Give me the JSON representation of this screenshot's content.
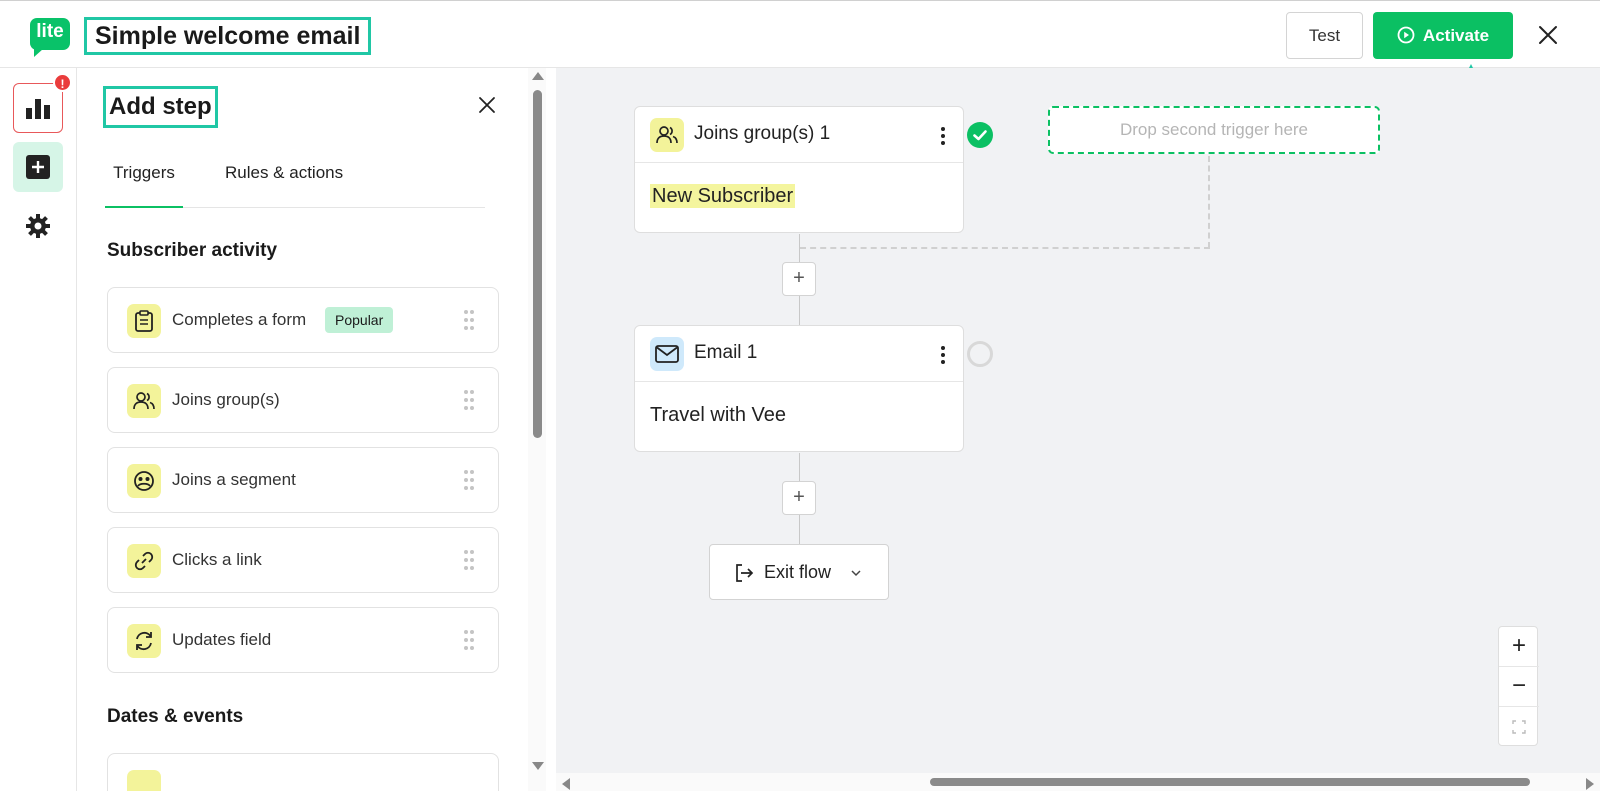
{
  "header": {
    "logo_text": "lite",
    "title": "Simple welcome email",
    "test_label": "Test",
    "activate_label": "Activate"
  },
  "rail": {
    "alert_badge": "!"
  },
  "panel": {
    "title": "Add step",
    "tabs": [
      {
        "label": "Triggers",
        "active": true
      },
      {
        "label": "Rules & actions",
        "active": false
      }
    ],
    "sections": [
      {
        "title": "Subscriber activity",
        "items": [
          {
            "label": "Completes a form",
            "icon": "clipboard-icon",
            "badge": "Popular"
          },
          {
            "label": "Joins group(s)",
            "icon": "users-icon"
          },
          {
            "label": "Joins a segment",
            "icon": "segment-icon"
          },
          {
            "label": "Clicks a link",
            "icon": "link-icon"
          },
          {
            "label": "Updates field",
            "icon": "refresh-icon"
          }
        ]
      },
      {
        "title": "Dates & events",
        "items": []
      }
    ]
  },
  "canvas": {
    "trigger_node": {
      "title": "Joins group(s) 1",
      "body": "New Subscriber",
      "status": "complete"
    },
    "drop_zone_text": "Drop second trigger here",
    "email_node": {
      "title": "Email 1",
      "body": "Travel with Vee",
      "status": "pending"
    },
    "add_step_symbol": "+",
    "exit_label": "Exit flow"
  },
  "zoom": {
    "in_symbol": "+",
    "out_symbol": "−"
  },
  "colors": {
    "brand_green": "#0bc063",
    "highlight_teal": "#20c7a5",
    "trigger_icon_bg": "#f3f39a",
    "email_icon_bg": "#cfe9fb",
    "alert_red": "#ea3c3c"
  }
}
